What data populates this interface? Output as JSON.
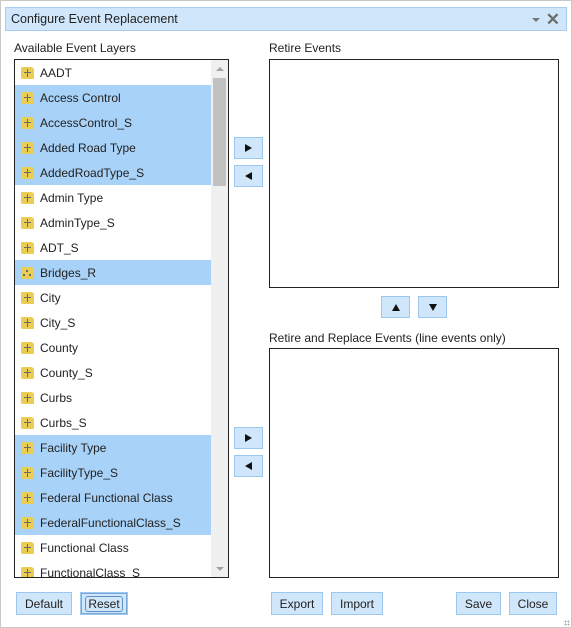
{
  "dialog": {
    "title": "Configure Event Replacement",
    "icons": {
      "menu": "chevron-down-icon",
      "close": "close-icon"
    }
  },
  "available": {
    "label": "Available Event Layers",
    "items": [
      {
        "label": "AADT",
        "icon": "line-layer-icon",
        "selected": false
      },
      {
        "label": "Access Control",
        "icon": "line-layer-icon",
        "selected": true
      },
      {
        "label": "AccessControl_S",
        "icon": "line-layer-icon",
        "selected": true
      },
      {
        "label": "Added Road Type",
        "icon": "line-layer-icon",
        "selected": true
      },
      {
        "label": "AddedRoadType_S",
        "icon": "line-layer-icon",
        "selected": true
      },
      {
        "label": "Admin Type",
        "icon": "line-layer-icon",
        "selected": false
      },
      {
        "label": "AdminType_S",
        "icon": "line-layer-icon",
        "selected": false
      },
      {
        "label": "ADT_S",
        "icon": "line-layer-icon",
        "selected": false
      },
      {
        "label": "Bridges_R",
        "icon": "point-layer-icon",
        "selected": true
      },
      {
        "label": "City",
        "icon": "line-layer-icon",
        "selected": false
      },
      {
        "label": "City_S",
        "icon": "line-layer-icon",
        "selected": false
      },
      {
        "label": "County",
        "icon": "line-layer-icon",
        "selected": false
      },
      {
        "label": "County_S",
        "icon": "line-layer-icon",
        "selected": false
      },
      {
        "label": "Curbs",
        "icon": "line-layer-icon",
        "selected": false
      },
      {
        "label": "Curbs_S",
        "icon": "line-layer-icon",
        "selected": false
      },
      {
        "label": "Facility Type",
        "icon": "line-layer-icon",
        "selected": true
      },
      {
        "label": "FacilityType_S",
        "icon": "line-layer-icon",
        "selected": true
      },
      {
        "label": "Federal Functional Class",
        "icon": "line-layer-icon",
        "selected": true
      },
      {
        "label": "FederalFunctionalClass_S",
        "icon": "line-layer-icon",
        "selected": true
      },
      {
        "label": "Functional Class",
        "icon": "line-layer-icon",
        "selected": false
      },
      {
        "label": "FunctionalClass_S",
        "icon": "line-layer-icon",
        "selected": false
      }
    ]
  },
  "retire": {
    "label": "Retire Events",
    "items": []
  },
  "replace": {
    "label": "Retire and Replace Events (line events only)",
    "items": []
  },
  "buttons": {
    "add_retire": "arrow-right-icon",
    "remove_retire": "arrow-left-icon",
    "move_up": "arrow-up-icon",
    "move_down": "arrow-down-icon",
    "add_replace": "arrow-right-icon",
    "remove_replace": "arrow-left-icon",
    "default": "Default",
    "reset": "Reset",
    "export": "Export",
    "import": "Import",
    "save": "Save",
    "close": "Close"
  },
  "colors": {
    "titlebar_bg": "#d0e6fa",
    "selection_bg": "#a8d2f8",
    "button_bg": "#d0e6fa",
    "layer_icon": "#e9cd55"
  }
}
